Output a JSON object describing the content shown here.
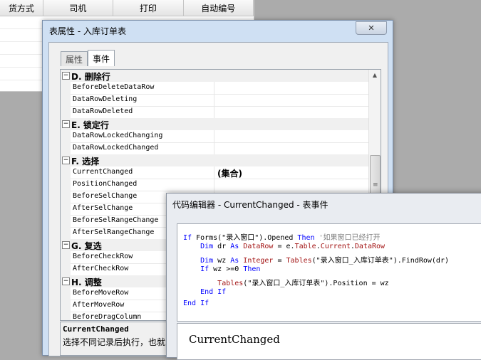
{
  "background_table": {
    "columns": [
      "货方式",
      "司机",
      "打印",
      "自动编号"
    ]
  },
  "properties_dialog": {
    "title": "表属性 - 入库订单表",
    "close_symbol": "✕",
    "tabs": [
      {
        "label": "属性",
        "active": false
      },
      {
        "label": "事件",
        "active": true
      }
    ],
    "groups": [
      {
        "name": "D. 删除行",
        "items": [
          {
            "name": "BeforeDeleteDataRow",
            "value": ""
          },
          {
            "name": "DataRowDeleting",
            "value": ""
          },
          {
            "name": "DataRowDeleted",
            "value": ""
          }
        ]
      },
      {
        "name": "E. 锁定行",
        "items": [
          {
            "name": "DataRowLockedChanging",
            "value": ""
          },
          {
            "name": "DataRowLockedChanged",
            "value": ""
          }
        ]
      },
      {
        "name": "F. 选择",
        "items": [
          {
            "name": "CurrentChanged",
            "value": "(集合)"
          },
          {
            "name": "PositionChanged",
            "value": ""
          },
          {
            "name": "BeforeSelChange",
            "value": ""
          },
          {
            "name": "AfterSelChange",
            "value": ""
          },
          {
            "name": "BeforeSelRangeChange",
            "value": ""
          },
          {
            "name": "AfterSelRangeChange",
            "value": ""
          }
        ]
      },
      {
        "name": "G. 复选",
        "items": [
          {
            "name": "BeforeCheckRow",
            "value": ""
          },
          {
            "name": "AfterCheckRow",
            "value": ""
          }
        ]
      },
      {
        "name": "H. 调整",
        "items": [
          {
            "name": "BeforeMoveRow",
            "value": ""
          },
          {
            "name": "AfterMoveRow",
            "value": ""
          },
          {
            "name": "BeforeDragColumn",
            "value": ""
          }
        ]
      }
    ],
    "description": {
      "name": "CurrentChanged",
      "text": "选择不同记录后执行，也就"
    }
  },
  "code_editor": {
    "title": "代码编辑器 - CurrentChanged - 表事件",
    "lines": [
      [
        {
          "t": "If ",
          "c": "kw"
        },
        {
          "t": "Forms(\"录入窗口\").Opened ",
          "c": "str"
        },
        {
          "t": "Then",
          "c": "kw"
        },
        {
          "t": " '如果窗口已经打开",
          "c": "cm"
        }
      ],
      [
        {
          "t": "    Dim ",
          "c": "kw"
        },
        {
          "t": "dr ",
          "c": "str"
        },
        {
          "t": "As ",
          "c": "kw"
        },
        {
          "t": "DataRow",
          "c": "ty"
        },
        {
          "t": " = e.",
          "c": "str"
        },
        {
          "t": "Table",
          "c": "ty"
        },
        {
          "t": ".",
          "c": "str"
        },
        {
          "t": "Current",
          "c": "ty"
        },
        {
          "t": ".",
          "c": "str"
        },
        {
          "t": "DataRow",
          "c": "ty"
        }
      ],
      [
        {
          "t": "    Dim ",
          "c": "kw"
        },
        {
          "t": "wz ",
          "c": "str"
        },
        {
          "t": "As ",
          "c": "kw"
        },
        {
          "t": "Integer",
          "c": "ty"
        },
        {
          "t": " = ",
          "c": "str"
        },
        {
          "t": "Tables",
          "c": "ty"
        },
        {
          "t": "(\"录入窗口_入库订单表\").FindRow(dr)",
          "c": "str"
        }
      ],
      [
        {
          "t": "    If ",
          "c": "kw"
        },
        {
          "t": "wz >=0 ",
          "c": "str"
        },
        {
          "t": "Then",
          "c": "kw"
        }
      ],
      [
        {
          "t": "        ",
          "c": "str"
        },
        {
          "t": "Tables",
          "c": "ty"
        },
        {
          "t": "(\"录入窗口_入库订单表\").Position = wz",
          "c": "str"
        }
      ],
      [
        {
          "t": "    End If",
          "c": "kw"
        }
      ],
      [
        {
          "t": "End If",
          "c": "kw"
        }
      ]
    ],
    "footer_title": "CurrentChanged"
  }
}
